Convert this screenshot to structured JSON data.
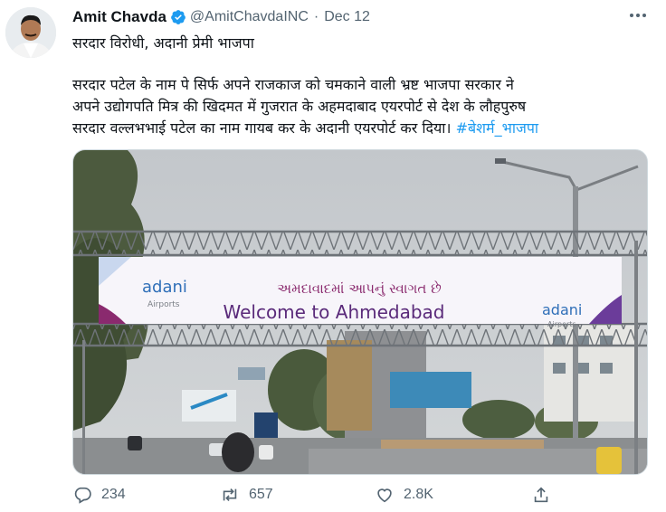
{
  "tweet": {
    "author_name": "Amit Chavda",
    "handle": "@AmitChavdaINC",
    "separator": "·",
    "date": "Dec 12",
    "line1": "सरदार विरोधी, अदानी प्रेमी भाजपा",
    "para_lines": [
      "सरदार पटेल के नाम पे सिर्फ अपने राजकाज को चमकाने वाली भ्रष्ट भाजपा सरकार ने",
      "अपने उद्योगपति मित्र की खिदमत में गुजरात के अहमदाबाद एयरपोर्ट से देश के लौहपुरुष",
      "सरदार वल्लभभाई पटेल का नाम गायब कर के अदानी एयरपोर्ट कर दिया।"
    ],
    "hashtag": "#बेशर्म_भाजपा",
    "replies": "234",
    "retweets": "657",
    "likes": "2.8K"
  },
  "media": {
    "banner_brand_left": "adani",
    "banner_sub_left": "Airports",
    "banner_gujarati": "અમદાવાદમાં આપનું સ્વાગત છે",
    "banner_english": "Welcome to Ahmedabad",
    "banner_brand_right": "adani",
    "banner_sub_right": "Airports"
  },
  "colors": {
    "accent": "#1d9bf0",
    "muted": "#536471",
    "text": "#0f1419"
  },
  "icons": [
    "more-icon",
    "verified-icon",
    "reply-icon",
    "retweet-icon",
    "like-icon",
    "share-icon"
  ]
}
